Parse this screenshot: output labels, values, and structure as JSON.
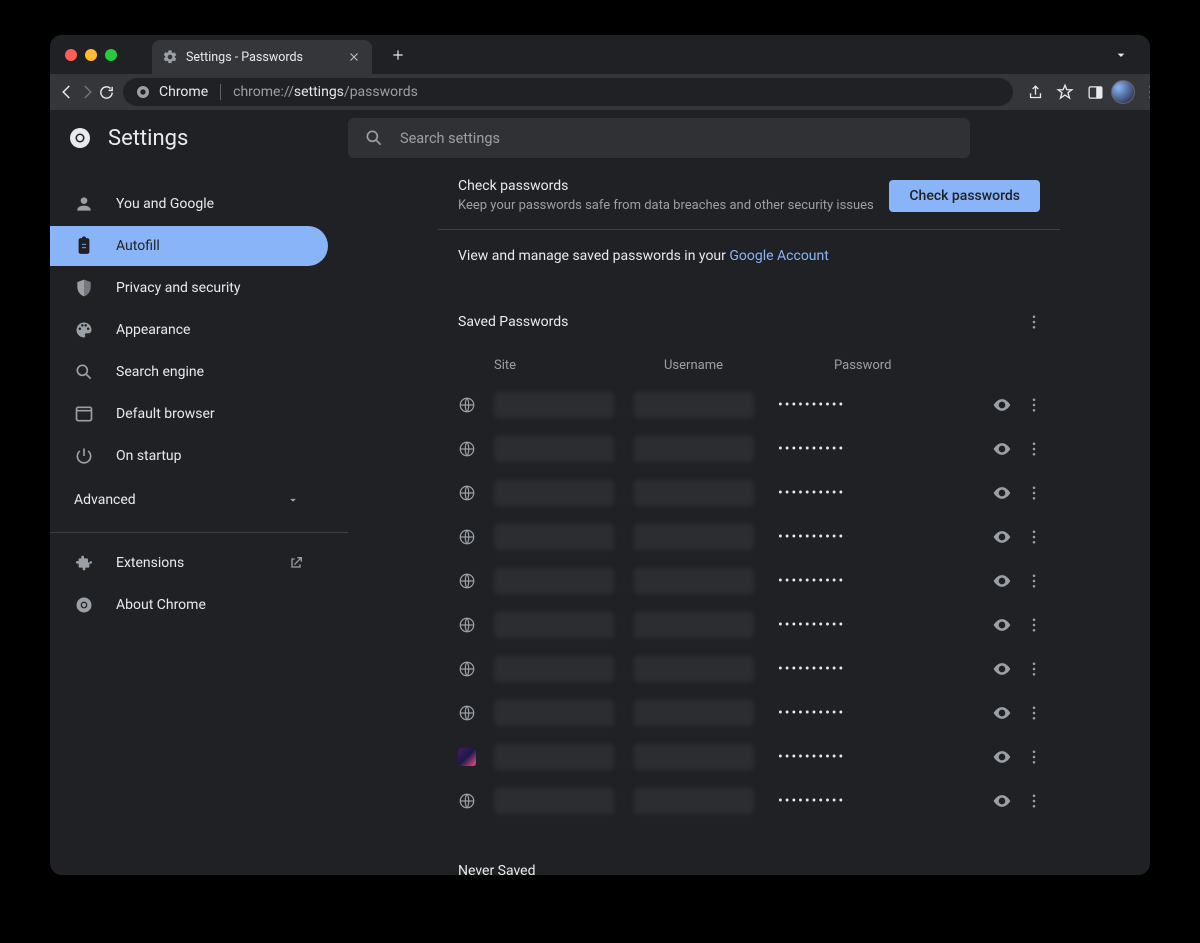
{
  "tab": {
    "title": "Settings - Passwords"
  },
  "omnibox": {
    "host_label": "Chrome",
    "url_prefix": "chrome://",
    "url_strong": "settings",
    "url_suffix": "/passwords"
  },
  "header": {
    "title": "Settings",
    "search_placeholder": "Search settings"
  },
  "sidebar": {
    "items": [
      {
        "label": "You and Google"
      },
      {
        "label": "Autofill"
      },
      {
        "label": "Privacy and security"
      },
      {
        "label": "Appearance"
      },
      {
        "label": "Search engine"
      },
      {
        "label": "Default browser"
      },
      {
        "label": "On startup"
      }
    ],
    "advanced_label": "Advanced",
    "extensions_label": "Extensions",
    "about_label": "About Chrome"
  },
  "check": {
    "title": "Check passwords",
    "subtitle": "Keep your passwords safe from data breaches and other security issues",
    "button": "Check passwords"
  },
  "google_account": {
    "prefix": "View and manage saved passwords in your ",
    "link": "Google Account"
  },
  "saved": {
    "section_title": "Saved Passwords",
    "col_site": "Site",
    "col_user": "Username",
    "col_pass": "Password",
    "rows": [
      {
        "favicon": "globe",
        "password_mask": "••••••••••"
      },
      {
        "favicon": "globe",
        "password_mask": "••••••••••"
      },
      {
        "favicon": "globe",
        "password_mask": "••••••••••"
      },
      {
        "favicon": "globe",
        "password_mask": "••••••••••"
      },
      {
        "favicon": "globe",
        "password_mask": "••••••••••"
      },
      {
        "favicon": "globe",
        "password_mask": "••••••••••"
      },
      {
        "favicon": "globe",
        "password_mask": "••••••••••"
      },
      {
        "favicon": "globe",
        "password_mask": "••••••••••"
      },
      {
        "favicon": "custom",
        "password_mask": "••••••••••"
      },
      {
        "favicon": "globe",
        "password_mask": "••••••••••"
      }
    ]
  },
  "never_saved": {
    "section_title": "Never Saved"
  }
}
